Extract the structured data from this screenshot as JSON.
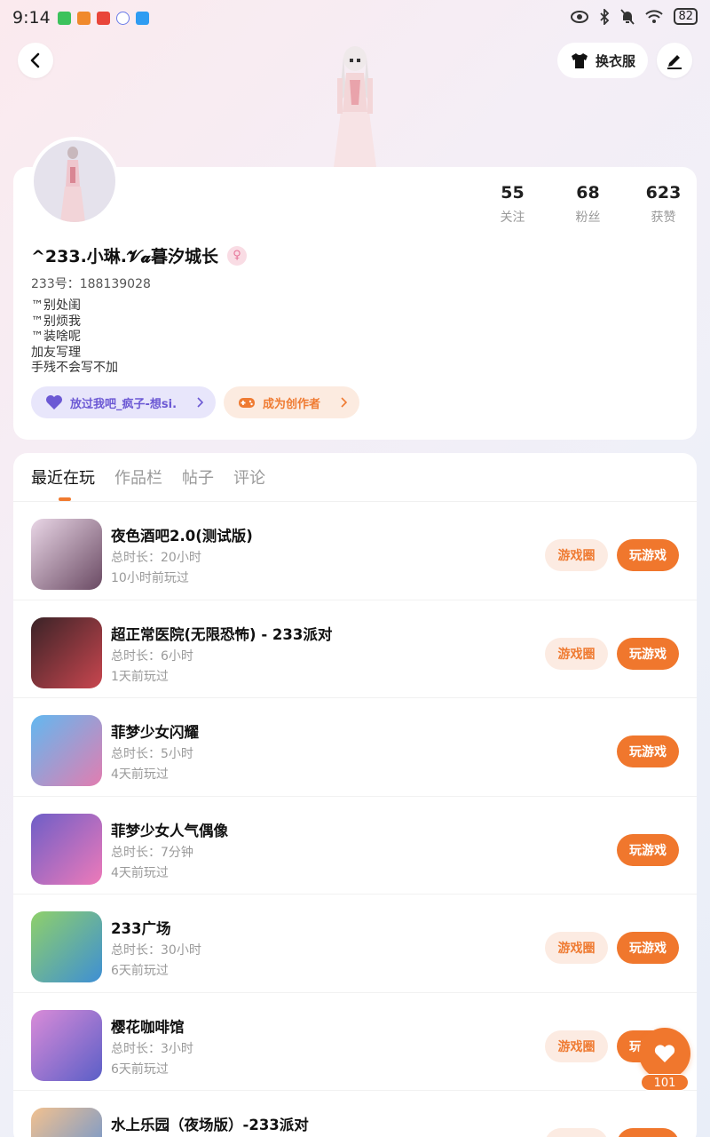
{
  "status_bar": {
    "time": "9:14",
    "battery": "82"
  },
  "header": {
    "outfit_label": "换衣服"
  },
  "profile": {
    "stats": [
      {
        "num": "55",
        "label": "关注"
      },
      {
        "num": "68",
        "label": "粉丝"
      },
      {
        "num": "623",
        "label": "获赞"
      }
    ],
    "name": "^233.小琳.𝓥𝓪暮汐城长",
    "uid": "233号：188139028",
    "bio": [
      "™别处闺",
      "™别烦我",
      "™装啥呢",
      "加友写理",
      "手残不会写不加"
    ],
    "chip_group": "放过我吧_疯子-想si.",
    "chip_creator": "成为创作者"
  },
  "tabs": [
    "最近在玩",
    "作品栏",
    "帖子",
    "评论"
  ],
  "buttons": {
    "circle": "游戏圈",
    "play": "玩游戏"
  },
  "games": [
    {
      "title": "夜色酒吧2.0(测试版)",
      "duration": "总时长：20小时",
      "last": "10小时前玩过",
      "has_circle": true,
      "colors": [
        "#e9d6e6",
        "#6a4a63"
      ]
    },
    {
      "title": "超正常医院(无限恐怖) - 233派对",
      "duration": "总时长：6小时",
      "last": "1天前玩过",
      "has_circle": true,
      "colors": [
        "#3a2327",
        "#c9464f"
      ]
    },
    {
      "title": "菲梦少女闪耀",
      "duration": "总时长：5小时",
      "last": "4天前玩过",
      "has_circle": false,
      "colors": [
        "#62b8f0",
        "#e27db0"
      ]
    },
    {
      "title": "菲梦少女人气偶像",
      "duration": "总时长：7分钟",
      "last": "4天前玩过",
      "has_circle": false,
      "colors": [
        "#6e5ec7",
        "#ee7ab9"
      ]
    },
    {
      "title": "233广场",
      "duration": "总时长：30小时",
      "last": "6天前玩过",
      "has_circle": true,
      "colors": [
        "#8fd06a",
        "#3e8fd4"
      ]
    },
    {
      "title": "樱花咖啡馆",
      "duration": "总时长：3小时",
      "last": "6天前玩过",
      "has_circle": true,
      "colors": [
        "#d98bd8",
        "#5b5fc7"
      ]
    },
    {
      "title": "水上乐园（夜场版）-233派对",
      "duration": "",
      "last": "",
      "has_circle": true,
      "colors": [
        "#f2c18f",
        "#5a8fd8"
      ]
    }
  ],
  "fab": {
    "count": "101"
  }
}
